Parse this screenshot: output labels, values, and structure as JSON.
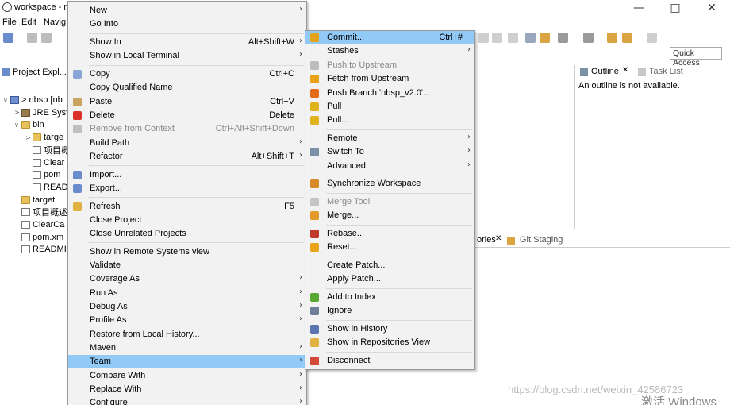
{
  "window": {
    "title": "workspace - n"
  },
  "menubar": [
    "File",
    "Edit",
    "Navig"
  ],
  "quick_access": "Quick Access",
  "project_explorer": {
    "tab_label": "Project Expl...",
    "tree": [
      {
        "label": "> nbsp [nb",
        "indent": 0,
        "twisty": "open",
        "icon": "proj"
      },
      {
        "label": "JRE Syst",
        "indent": 1,
        "twisty": "closed",
        "icon": "jar"
      },
      {
        "label": "bin",
        "indent": 1,
        "twisty": "open",
        "icon": "folder"
      },
      {
        "label": "targe",
        "indent": 2,
        "twisty": "closed",
        "icon": "folder"
      },
      {
        "label": "项目概",
        "indent": 2,
        "twisty": "",
        "icon": "file"
      },
      {
        "label": "Clear",
        "indent": 2,
        "twisty": "",
        "icon": "file"
      },
      {
        "label": "pom",
        "indent": 2,
        "twisty": "",
        "icon": "file"
      },
      {
        "label": "READ",
        "indent": 2,
        "twisty": "",
        "icon": "file"
      },
      {
        "label": "target",
        "indent": 1,
        "twisty": "",
        "icon": "folder"
      },
      {
        "label": "项目概述",
        "indent": 1,
        "twisty": "",
        "icon": "file"
      },
      {
        "label": "ClearCa",
        "indent": 1,
        "twisty": "",
        "icon": "file"
      },
      {
        "label": "pom.xm",
        "indent": 1,
        "twisty": "",
        "icon": "file"
      },
      {
        "label": "READMI",
        "indent": 1,
        "twisty": "",
        "icon": "file"
      }
    ]
  },
  "outline": {
    "tab_outline": "Outline",
    "tab_tasks": "Task List",
    "message": "An outline is not available."
  },
  "bottom_tabs": {
    "left": "ories",
    "git_staging": "Git Staging"
  },
  "watermark": {
    "url": "https://blog.csdn.net/weixin_42586723",
    "activate": "激活 Windows"
  },
  "context_menu": [
    {
      "label": "New",
      "sc": "",
      "sub": true,
      "icon": "",
      "sel": false,
      "dis": false
    },
    {
      "label": "Go Into",
      "sc": "",
      "sub": false,
      "icon": "",
      "sel": false,
      "dis": false
    },
    {
      "sep": true
    },
    {
      "label": "Show In",
      "sc": "Alt+Shift+W",
      "sub": true,
      "icon": "",
      "sel": false,
      "dis": false
    },
    {
      "label": "Show in Local Terminal",
      "sc": "",
      "sub": true,
      "icon": "",
      "sel": false,
      "dis": false
    },
    {
      "sep": true
    },
    {
      "label": "Copy",
      "sc": "Ctrl+C",
      "sub": false,
      "icon": "#8aa6d6",
      "sel": false,
      "dis": false
    },
    {
      "label": "Copy Qualified Name",
      "sc": "",
      "sub": false,
      "icon": "",
      "sel": false,
      "dis": false
    },
    {
      "label": "Paste",
      "sc": "Ctrl+V",
      "sub": false,
      "icon": "#c9a45e",
      "sel": false,
      "dis": false
    },
    {
      "label": "Delete",
      "sc": "Delete",
      "sub": false,
      "icon": "#d9312a",
      "sel": false,
      "dis": false
    },
    {
      "label": "Remove from Context",
      "sc": "Ctrl+Alt+Shift+Down",
      "sub": false,
      "icon": "#c0c0c0",
      "sel": false,
      "dis": true
    },
    {
      "label": "Build Path",
      "sc": "",
      "sub": true,
      "icon": "",
      "sel": false,
      "dis": false
    },
    {
      "label": "Refactor",
      "sc": "Alt+Shift+T",
      "sub": true,
      "icon": "",
      "sel": false,
      "dis": false
    },
    {
      "sep": true
    },
    {
      "label": "Import...",
      "sc": "",
      "sub": false,
      "icon": "#6b8ccc",
      "sel": false,
      "dis": false
    },
    {
      "label": "Export...",
      "sc": "",
      "sub": false,
      "icon": "#6b8ccc",
      "sel": false,
      "dis": false
    },
    {
      "sep": true
    },
    {
      "label": "Refresh",
      "sc": "F5",
      "sub": false,
      "icon": "#e0b040",
      "sel": false,
      "dis": false
    },
    {
      "label": "Close Project",
      "sc": "",
      "sub": false,
      "icon": "",
      "sel": false,
      "dis": false
    },
    {
      "label": "Close Unrelated Projects",
      "sc": "",
      "sub": false,
      "icon": "",
      "sel": false,
      "dis": false
    },
    {
      "sep": true
    },
    {
      "label": "Show in Remote Systems view",
      "sc": "",
      "sub": false,
      "icon": "",
      "sel": false,
      "dis": false
    },
    {
      "label": "Validate",
      "sc": "",
      "sub": false,
      "icon": "",
      "sel": false,
      "dis": false
    },
    {
      "label": "Coverage As",
      "sc": "",
      "sub": true,
      "icon": "",
      "sel": false,
      "dis": false
    },
    {
      "label": "Run As",
      "sc": "",
      "sub": true,
      "icon": "",
      "sel": false,
      "dis": false
    },
    {
      "label": "Debug As",
      "sc": "",
      "sub": true,
      "icon": "",
      "sel": false,
      "dis": false
    },
    {
      "label": "Profile As",
      "sc": "",
      "sub": true,
      "icon": "",
      "sel": false,
      "dis": false
    },
    {
      "label": "Restore from Local History...",
      "sc": "",
      "sub": false,
      "icon": "",
      "sel": false,
      "dis": false
    },
    {
      "label": "Maven",
      "sc": "",
      "sub": true,
      "icon": "",
      "sel": false,
      "dis": false
    },
    {
      "label": "Team",
      "sc": "",
      "sub": true,
      "icon": "",
      "sel": true,
      "dis": false
    },
    {
      "label": "Compare With",
      "sc": "",
      "sub": true,
      "icon": "",
      "sel": false,
      "dis": false
    },
    {
      "label": "Replace With",
      "sc": "",
      "sub": true,
      "icon": "",
      "sel": false,
      "dis": false
    },
    {
      "label": "Configure",
      "sc": "",
      "sub": true,
      "icon": "",
      "sel": false,
      "dis": false
    }
  ],
  "team_menu": [
    {
      "label": "Commit...",
      "sc": "Ctrl+#",
      "sub": false,
      "icon": "#e3a21a",
      "sel": true,
      "dis": false
    },
    {
      "label": "Stashes",
      "sc": "",
      "sub": true,
      "icon": "",
      "sel": false,
      "dis": false
    },
    {
      "label": "Push to Upstream",
      "sc": "",
      "sub": false,
      "icon": "#bdbdbd",
      "sel": false,
      "dis": true
    },
    {
      "label": "Fetch from Upstream",
      "sc": "",
      "sub": false,
      "icon": "#e8a317",
      "sel": false,
      "dis": false
    },
    {
      "label": "Push Branch 'nbsp_v2.0'...",
      "sc": "",
      "sub": false,
      "icon": "#e46a1b",
      "sel": false,
      "dis": false
    },
    {
      "label": "Pull",
      "sc": "",
      "sub": false,
      "icon": "#e0b21c",
      "sel": false,
      "dis": false
    },
    {
      "label": "Pull...",
      "sc": "",
      "sub": false,
      "icon": "#e0b21c",
      "sel": false,
      "dis": false
    },
    {
      "sep": true
    },
    {
      "label": "Remote",
      "sc": "",
      "sub": true,
      "icon": "",
      "sel": false,
      "dis": false
    },
    {
      "label": "Switch To",
      "sc": "",
      "sub": true,
      "icon": "#7c90a8",
      "sel": false,
      "dis": false
    },
    {
      "label": "Advanced",
      "sc": "",
      "sub": true,
      "icon": "",
      "sel": false,
      "dis": false
    },
    {
      "sep": true
    },
    {
      "label": "Synchronize Workspace",
      "sc": "",
      "sub": false,
      "icon": "#d88a2a",
      "sel": false,
      "dis": false
    },
    {
      "sep": true
    },
    {
      "label": "Merge Tool",
      "sc": "",
      "sub": false,
      "icon": "#c4c4c4",
      "sel": false,
      "dis": true
    },
    {
      "label": "Merge...",
      "sc": "",
      "sub": false,
      "icon": "#e39a2a",
      "sel": false,
      "dis": false
    },
    {
      "sep": true
    },
    {
      "label": "Rebase...",
      "sc": "",
      "sub": false,
      "icon": "#c0392b",
      "sel": false,
      "dis": false
    },
    {
      "label": "Reset...",
      "sc": "",
      "sub": false,
      "icon": "#e8a317",
      "sel": false,
      "dis": false
    },
    {
      "sep": true
    },
    {
      "label": "Create Patch...",
      "sc": "",
      "sub": false,
      "icon": "",
      "sel": false,
      "dis": false
    },
    {
      "label": "Apply Patch...",
      "sc": "",
      "sub": false,
      "icon": "",
      "sel": false,
      "dis": false
    },
    {
      "sep": true
    },
    {
      "label": "Add to Index",
      "sc": "",
      "sub": false,
      "icon": "#5aa632",
      "sel": false,
      "dis": false
    },
    {
      "label": "Ignore",
      "sc": "",
      "sub": false,
      "icon": "#6f7f99",
      "sel": false,
      "dis": false
    },
    {
      "sep": true
    },
    {
      "label": "Show in History",
      "sc": "",
      "sub": false,
      "icon": "#5a74b0",
      "sel": false,
      "dis": false
    },
    {
      "label": "Show in Repositories View",
      "sc": "",
      "sub": false,
      "icon": "#e0b040",
      "sel": false,
      "dis": false
    },
    {
      "sep": true
    },
    {
      "label": "Disconnect",
      "sc": "",
      "sub": false,
      "icon": "#d44a3a",
      "sel": false,
      "dis": false
    }
  ]
}
